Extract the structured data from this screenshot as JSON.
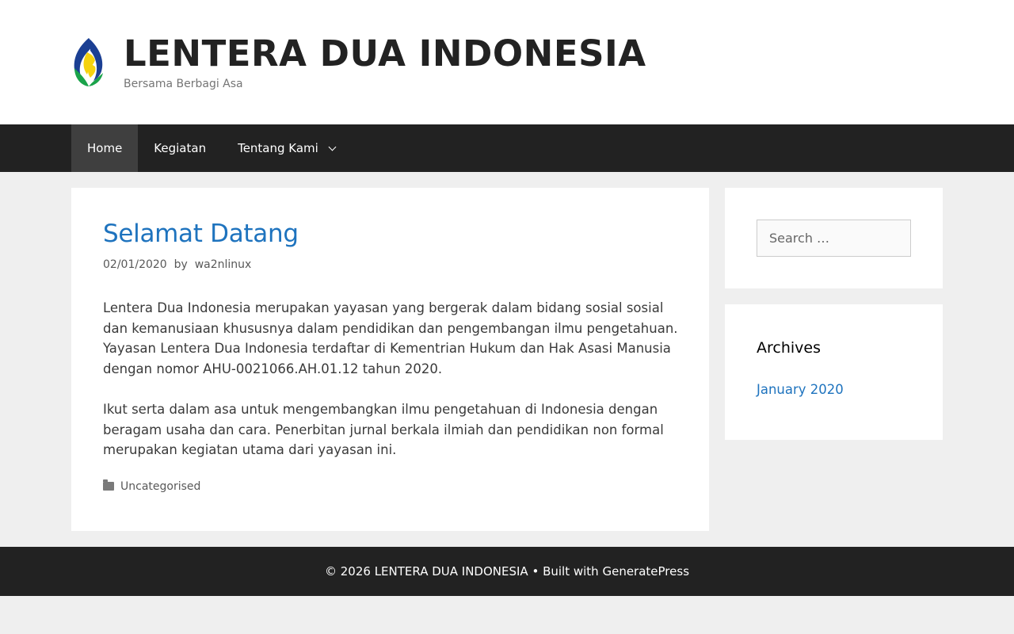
{
  "site": {
    "title": "LENTERA DUA INDONESIA",
    "tagline": "Bersama Berbagi Asa",
    "logo": "flame-logo"
  },
  "nav": {
    "items": [
      {
        "label": "Home",
        "active": true
      },
      {
        "label": "Kegiatan"
      },
      {
        "label": "Tentang Kami",
        "has_submenu": true
      }
    ]
  },
  "post": {
    "title": "Selamat Datang",
    "date": "02/01/2020",
    "by": "by",
    "author": "wa2nlinux",
    "paragraphs": [
      "Lentera Dua Indonesia merupakan yayasan yang bergerak dalam bidang sosial sosial dan kemanusiaan khususnya dalam pendidikan dan pengembangan ilmu pengetahuan. Yayasan Lentera Dua Indonesia terdaftar di Kementrian Hukum dan Hak Asasi Manusia dengan nomor AHU-0021066.AH.01.12 tahun 2020.",
      "Ikut serta dalam asa untuk mengembangkan ilmu pengetahuan di Indonesia dengan beragam usaha dan cara. Penerbitan jurnal berkala ilmiah dan pendidikan non formal merupakan kegiatan utama dari yayasan ini."
    ],
    "category": "Uncategorised"
  },
  "sidebar": {
    "search_placeholder": "Search …",
    "archives_title": "Archives",
    "archives": [
      "January 2020"
    ]
  },
  "footer": {
    "copyright": "© 2026 LENTERA DUA INDONESIA",
    "separator": " • Built with ",
    "theme": "GeneratePress"
  },
  "colors": {
    "link": "#1e73be",
    "nav_bg": "#222222",
    "nav_active": "#3f3f3f",
    "body_bg": "#efefef"
  }
}
